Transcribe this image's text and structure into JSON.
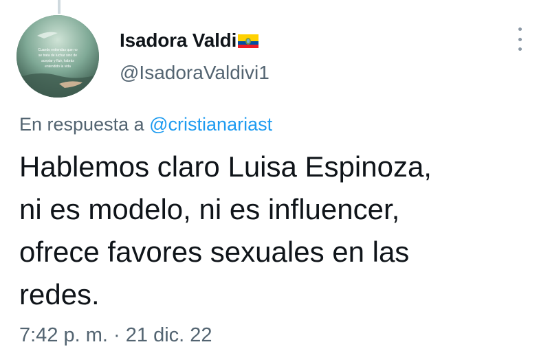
{
  "tweet": {
    "author": {
      "display_name": "Isadora Valdi",
      "flag_icon": "ecuador-flag-icon",
      "handle": "@IsadoraValdivi1",
      "avatar_text": [
        "Cuando entiendas que no",
        "se trata de luchar sino de",
        "aceptar y fluir, habrás",
        "entendido la vida"
      ]
    },
    "reply_prefix": "En respuesta a",
    "reply_handle": "@cristianariast",
    "text_lines": [
      "Hablemos claro Luisa Espinoza,",
      "ni es modelo, ni es influencer,",
      "ofrece favores sexuales en las",
      "redes."
    ],
    "time": "7:42 p. m.",
    "separator": "·",
    "date": "21 dic. 22",
    "more_icon": "more-options-icon"
  },
  "colors": {
    "text_primary": "#0f1419",
    "text_secondary": "#536471",
    "link": "#1d9bf0",
    "thread_line": "#cfd9de"
  }
}
